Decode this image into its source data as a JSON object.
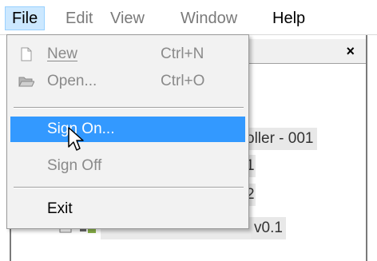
{
  "menubar": {
    "items": [
      {
        "label": "File",
        "state": "active"
      },
      {
        "label": "Edit",
        "state": "disabled"
      },
      {
        "label": "View",
        "state": "disabled"
      },
      {
        "label": "Window",
        "state": "disabled"
      },
      {
        "label": "Help",
        "state": "enabled"
      }
    ]
  },
  "file_menu": {
    "items": [
      {
        "label": "New",
        "mnemonic": "N",
        "shortcut": "Ctrl+N",
        "enabled": false,
        "icon": "new-file-icon"
      },
      {
        "label": "Open...",
        "mnemonic": "O",
        "shortcut": "Ctrl+O",
        "enabled": false,
        "icon": "open-folder-icon"
      },
      {
        "label": "Sign On...",
        "mnemonic": "g",
        "shortcut": "",
        "enabled": true,
        "highlighted": true
      },
      {
        "label": "Sign Off",
        "mnemonic": "g",
        "shortcut": "",
        "enabled": false
      },
      {
        "label": "Exit",
        "mnemonic": "x",
        "shortcut": "",
        "enabled": true
      }
    ]
  },
  "background_window": {
    "close_symbol": "×",
    "tree_items": [
      "oller - 001",
      "1",
      "2",
      "v0.1"
    ]
  },
  "colors": {
    "highlight": "#3399ff",
    "menu_bg": "#f2f2f2",
    "active_menu_bg": "#cce8ff"
  }
}
